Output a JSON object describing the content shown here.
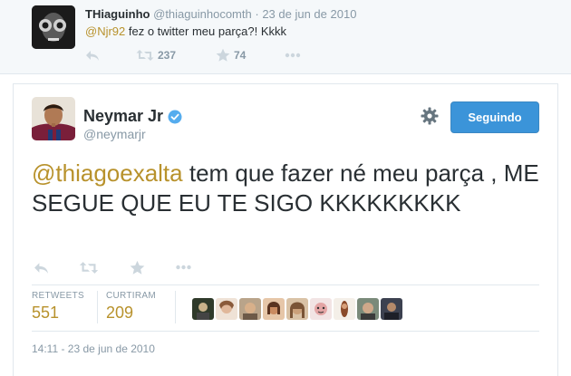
{
  "reply_tweet": {
    "name": "THiaguinho",
    "handle": "@thiaguinhocomth",
    "separator": "·",
    "date": "23 de jun de 2010",
    "mention": "@Njr92",
    "text": " fez o twitter meu parça?! Kkkk",
    "retweet_count": "237",
    "favorite_count": "74",
    "icons": [
      "reply-icon",
      "retweet-icon",
      "star-icon",
      "more-icon"
    ]
  },
  "main_tweet": {
    "name": "Neymar Jr",
    "handle": "@neymarjr",
    "follow_button": "Seguindo",
    "mention": "@thiagoexalta",
    "text": " tem que fazer né meu parça , ME SEGUE QUE EU TE SIGO KKKKKKKKK",
    "retweets_label": "RETWEETS",
    "retweets_value": "551",
    "likes_label": "CURTIRAM",
    "likes_value": "209",
    "timestamp": "14:11 - 23 de jun de 2010",
    "icons": [
      "reply-icon",
      "retweet-icon",
      "star-icon",
      "more-icon",
      "gear-icon",
      "verified-icon"
    ]
  },
  "colors": {
    "link": "#b8922c",
    "button": "#3b94d9",
    "muted": "#8899a6",
    "text": "#292f33",
    "reply_bg": "#f5f8fa"
  }
}
